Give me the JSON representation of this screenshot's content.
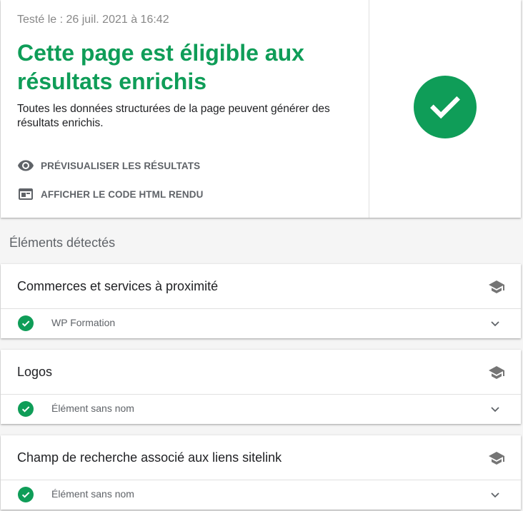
{
  "summary": {
    "tested_date": "Testé le : 26 juil. 2021 à 16:42",
    "verdict_title": "Cette page est éligible aux résultats enrichis",
    "verdict_description": "Toutes les données structurées de la page peuvent générer des résultats enrichis.",
    "actions": [
      {
        "label": "PRÉVISUALISER LES RÉSULTATS",
        "icon": "eye-icon"
      },
      {
        "label": "AFFICHER LE CODE HTML RENDU",
        "icon": "web-page-icon"
      }
    ],
    "status_icon": "check-circle-icon"
  },
  "detected": {
    "title": "Éléments détectés",
    "items": [
      {
        "title": "Commerces et services à proximité",
        "row_label": "WP Formation",
        "status": "valid"
      },
      {
        "title": "Logos",
        "row_label": "Élément sans nom",
        "status": "valid"
      },
      {
        "title": "Champ de recherche associé aux liens sitelink",
        "row_label": "Élément sans nom",
        "status": "valid"
      }
    ]
  },
  "colors": {
    "success": "#0f9d58",
    "muted_text": "#5f6368",
    "divider": "#e0e0e0"
  }
}
